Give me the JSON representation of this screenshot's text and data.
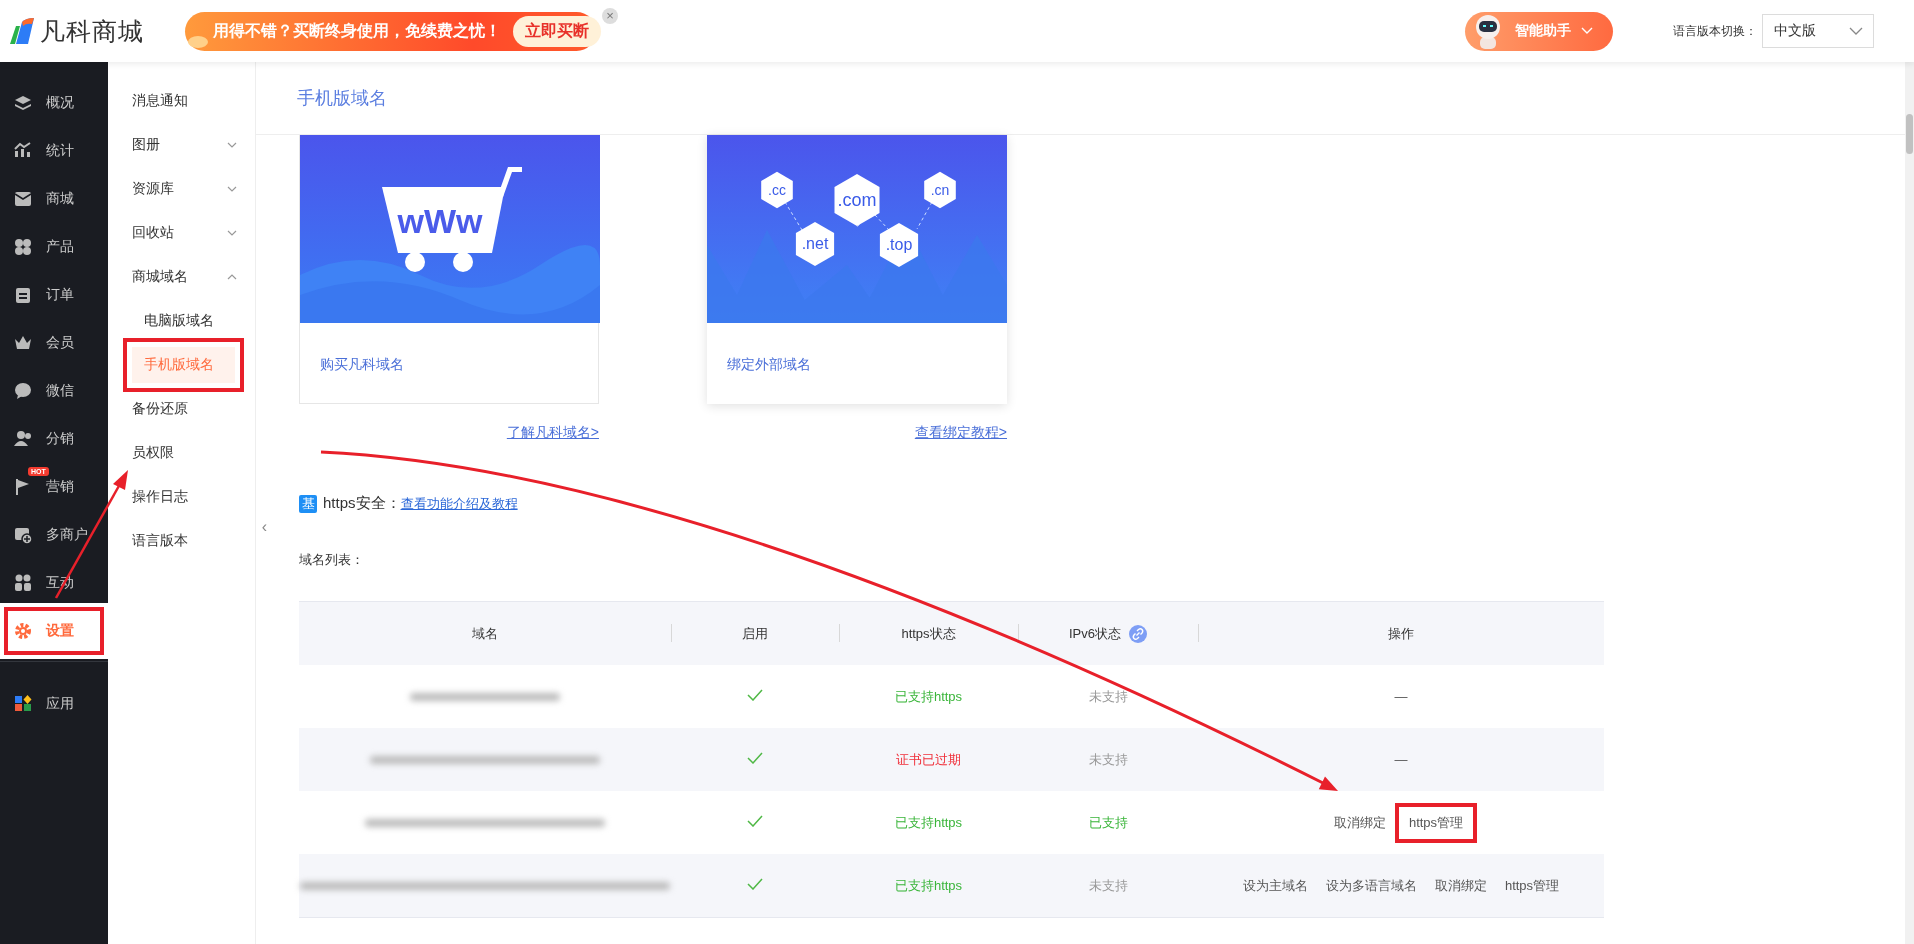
{
  "header": {
    "logo_text": "凡科商城",
    "promo": {
      "text": "用得不错？买断终身使用，免续费之忧！",
      "button": "立即买断",
      "close": "×"
    },
    "assistant": {
      "label": "智能助手"
    },
    "language": {
      "label": "语言版本切换：",
      "value": "中文版"
    }
  },
  "main_nav": [
    {
      "label": "概况",
      "selected": false,
      "highlighted": false
    },
    {
      "label": "统计",
      "selected": false,
      "highlighted": false
    },
    {
      "label": "商城",
      "selected": false,
      "highlighted": false
    },
    {
      "label": "产品",
      "selected": false,
      "highlighted": false
    },
    {
      "label": "订单",
      "selected": false,
      "highlighted": false
    },
    {
      "label": "会员",
      "selected": false,
      "highlighted": false
    },
    {
      "label": "微信",
      "selected": false,
      "highlighted": false
    },
    {
      "label": "分销",
      "selected": false,
      "highlighted": false
    },
    {
      "label": "营销",
      "badge": "HOT",
      "selected": false,
      "highlighted": false
    },
    {
      "label": "多商户",
      "selected": false,
      "highlighted": false
    },
    {
      "label": "互动",
      "selected": false,
      "highlighted": false
    },
    {
      "label": "设置",
      "selected": true,
      "highlighted": true
    },
    {
      "label": "应用",
      "selected": false,
      "highlighted": false
    }
  ],
  "sub_nav": [
    {
      "label": "消息通知"
    },
    {
      "label": "图册",
      "expanded": false
    },
    {
      "label": "资源库",
      "expanded": false
    },
    {
      "label": "回收站",
      "expanded": false
    },
    {
      "label": "商城域名",
      "expanded": true,
      "children": [
        {
          "label": "电脑版域名",
          "selected": false,
          "highlighted": false
        },
        {
          "label": "手机版域名",
          "selected": true,
          "highlighted": true
        }
      ]
    },
    {
      "label": "备份还原"
    },
    {
      "label": "员权限"
    },
    {
      "label": "操作日志"
    },
    {
      "label": "语言版本"
    }
  ],
  "collapse_toggle": "‹",
  "page_title": "手机版域名",
  "cards": [
    {
      "kind": "cart",
      "art_text": [
        "wWw"
      ],
      "title": "购买凡科域名",
      "link": "了解凡科域名>",
      "raised": false
    },
    {
      "kind": "domains",
      "art_text": [
        ".cc",
        ".com",
        ".cn",
        ".net",
        ".top"
      ],
      "title": "绑定外部域名",
      "link": "查看绑定教程>",
      "raised": true
    }
  ],
  "https_note": {
    "badge": "基",
    "label": "https安全：",
    "link": "查看功能介绍及教程"
  },
  "list_label": "域名列表：",
  "table": {
    "columns": [
      {
        "label": "域名"
      },
      {
        "label": "启用"
      },
      {
        "label": "https状态"
      },
      {
        "label": "IPv6状态",
        "link_icon": true
      },
      {
        "label": "操作"
      }
    ],
    "rows": [
      {
        "enabled": true,
        "https": {
          "text": "已支持https",
          "expired": false
        },
        "ipv6": {
          "text": "未支持",
          "supported": false
        },
        "actions": [
          {
            "label": "—",
            "highlighted": false
          }
        ]
      },
      {
        "enabled": true,
        "https": {
          "text": "证书已过期",
          "expired": true
        },
        "ipv6": {
          "text": "未支持",
          "supported": false
        },
        "actions": [
          {
            "label": "—",
            "highlighted": false
          }
        ]
      },
      {
        "enabled": true,
        "https": {
          "text": "已支持https",
          "expired": false
        },
        "ipv6": {
          "text": "已支持",
          "supported": true
        },
        "actions": [
          {
            "label": "取消绑定",
            "highlighted": false
          },
          {
            "label": "https管理",
            "highlighted": true
          }
        ]
      },
      {
        "enabled": true,
        "https": {
          "text": "已支持https",
          "expired": false
        },
        "ipv6": {
          "text": "未支持",
          "supported": false
        },
        "actions": [
          {
            "label": "设为主域名",
            "highlighted": false
          },
          {
            "label": "设为多语言域名",
            "highlighted": false
          },
          {
            "label": "取消绑定",
            "highlighted": false
          },
          {
            "label": "https管理",
            "highlighted": false
          }
        ]
      }
    ]
  }
}
